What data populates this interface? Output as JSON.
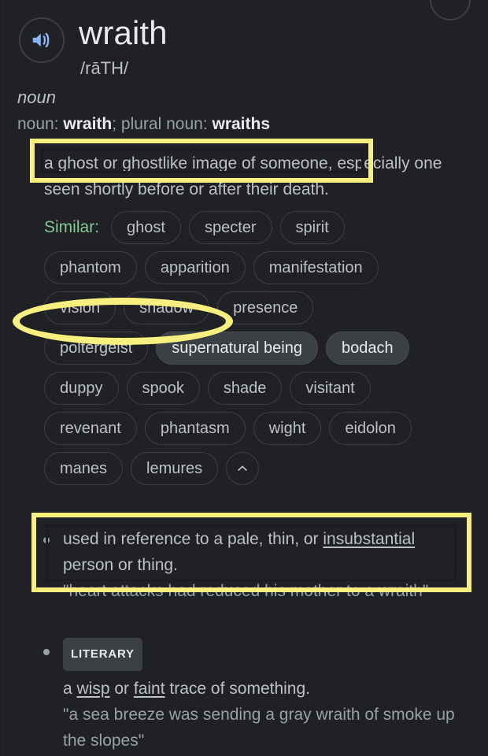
{
  "entry": {
    "headword": "wraith",
    "pronunciation": "/rāTH/",
    "part_of_speech": "noun",
    "audio_icon": "speaker-icon",
    "audio_icon_color": "#8ab4f8"
  },
  "inflections": {
    "label_singular": "noun",
    "separator_1": ": ",
    "form_singular": "wraith",
    "separator_2": "; ",
    "label_plural": "plural noun",
    "separator_3": ": ",
    "form_plural": "wraiths"
  },
  "senses": [
    {
      "id": "sense-1",
      "text": "a ghost or ghostlike image of someone, especially one seen shortly before or after their death."
    },
    {
      "id": "sense-2",
      "text_before_link": "used in reference to a pale, thin, or ",
      "link_text": "insubstantial",
      "text_after_link": " person or thing.",
      "quote": "\"heart attacks had reduced his mother to a wraith\""
    },
    {
      "id": "sense-3",
      "badge": "LITERARY",
      "text_part_1": "a ",
      "link_1": "wisp",
      "text_part_2": " or ",
      "link_2": "faint",
      "text_part_3": " trace of something.",
      "quote": "\"a sea breeze was sending a gray wraith of smoke up the slopes\""
    }
  ],
  "synonyms": {
    "label": "Similar:",
    "label_color": "#81c995",
    "rows": [
      [
        "ghost",
        "specter",
        "spirit"
      ],
      [
        "phantom",
        "apparition",
        "manifestation"
      ],
      [
        "vision",
        "shadow",
        "presence"
      ],
      [
        "poltergeist",
        "supernatural being",
        "bodach"
      ],
      [
        "duppy",
        "spook",
        "shade",
        "visitant"
      ],
      [
        "revenant",
        "phantasm",
        "wight",
        "eidolon"
      ],
      [
        "manes",
        "lemures"
      ]
    ],
    "filled_chips": [
      "supernatural being",
      "bodach"
    ],
    "collapse_icon": "chevron-up-icon"
  },
  "annotations": {
    "highlight_color": "#f7ef7e",
    "items": [
      {
        "name": "highlight-sense-1",
        "shape": "rectangle"
      },
      {
        "name": "highlight-vision-shadow",
        "shape": "ellipse"
      },
      {
        "name": "highlight-sense-2",
        "shape": "rectangle"
      }
    ]
  },
  "colors": {
    "background": "#202124",
    "text_primary": "#e8eaed",
    "text_secondary": "#bdc1c6",
    "text_muted": "#9aa0a6",
    "chip_border": "#3c4043",
    "chip_filled": "#3c4043"
  }
}
